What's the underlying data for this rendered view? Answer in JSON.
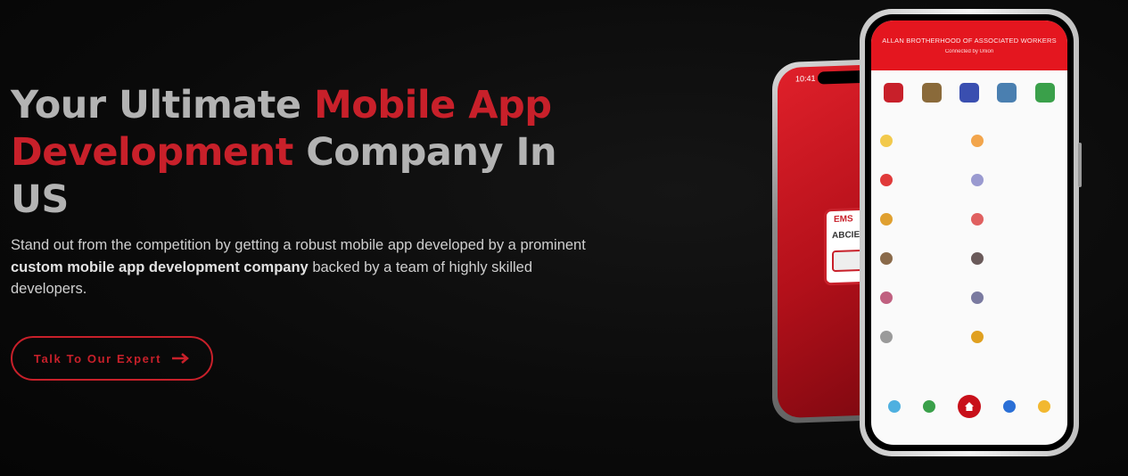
{
  "hero": {
    "headline_part1": "Your Ultimate ",
    "headline_accent1": "Mobile App",
    "headline_accent2": "Development",
    "headline_part2": " Company In",
    "headline_part3": "US",
    "sub_part1": "Stand out from the competition by getting a robust mobile app developed by a prominent ",
    "sub_bold": "custom mobile app development company",
    "sub_part2": " backed by a team of highly skilled developers.",
    "cta_label": "Talk To Our Expert",
    "cta_icon": "arrow-right-icon"
  },
  "phone_back": {
    "time": "10:41",
    "card_label": "EMS",
    "card_letters": "ABCIEF"
  },
  "phone_front": {
    "header_title": "ALLAN BROTHERHOOD OF ASSOCIATED WORKERS",
    "header_subtitle": "Connected by Union"
  },
  "colors": {
    "accent": "#c8202a",
    "headline_gray": "#b3b3b3",
    "background": "#0a0a0a"
  }
}
